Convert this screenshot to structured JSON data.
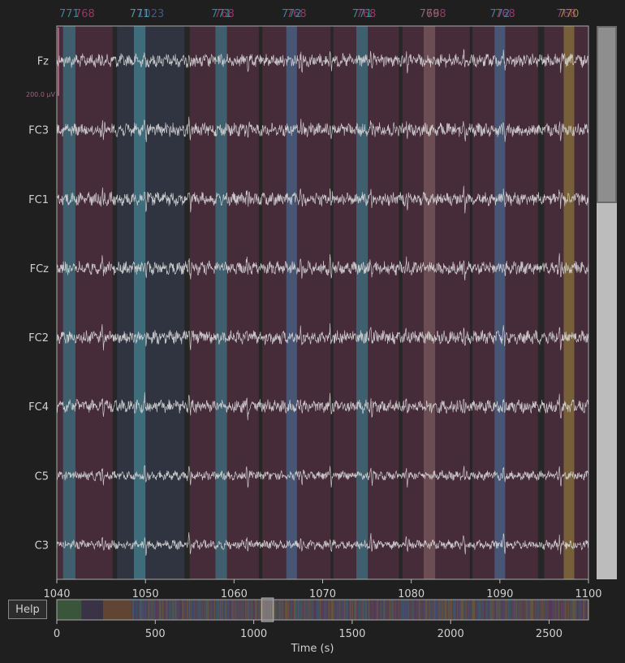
{
  "chart_data": {
    "type": "line",
    "channels": [
      "Fz",
      "FC3",
      "FC1",
      "FCz",
      "FC2",
      "FC4",
      "C5",
      "C3"
    ],
    "xlim": [
      1040,
      1100
    ],
    "xticks": [
      "1040",
      "1050",
      "1060",
      "1070",
      "1080",
      "1090",
      "1100"
    ],
    "scale_label": "200.0 µV",
    "annotations": [
      {
        "label": "768",
        "start": 1040.0,
        "end": 1046.3,
        "color": "#9b3a6a"
      },
      {
        "label": "771",
        "start": 1040.7,
        "end": 1042.1,
        "color": "#3a8a9a"
      },
      {
        "label": "1023",
        "start": 1046.8,
        "end": 1054.4,
        "color": "#4a5a8a"
      },
      {
        "label": "771",
        "start": 1048.7,
        "end": 1050.0,
        "color": "#4a9aaa"
      },
      {
        "label": "768",
        "start": 1055.0,
        "end": 1062.8,
        "color": "#9b3a6a"
      },
      {
        "label": "771",
        "start": 1057.9,
        "end": 1059.2,
        "color": "#3a8a9a"
      },
      {
        "label": "768",
        "start": 1063.2,
        "end": 1070.9,
        "color": "#9b3a6a"
      },
      {
        "label": "772",
        "start": 1065.9,
        "end": 1067.1,
        "color": "#4a7aa8"
      },
      {
        "label": "768",
        "start": 1071.2,
        "end": 1078.6,
        "color": "#9b3a6a"
      },
      {
        "label": "771",
        "start": 1073.8,
        "end": 1075.1,
        "color": "#3a8a9a"
      },
      {
        "label": "768",
        "start": 1079.0,
        "end": 1086.6,
        "color": "#9b3a6a"
      },
      {
        "label": "769",
        "start": 1081.4,
        "end": 1082.7,
        "color": "#8a6a6a"
      },
      {
        "label": "768",
        "start": 1086.9,
        "end": 1094.3,
        "color": "#9b3a6a"
      },
      {
        "label": "772",
        "start": 1089.4,
        "end": 1090.6,
        "color": "#4a7aa8"
      },
      {
        "label": "768",
        "start": 1095.0,
        "end": 1100.0,
        "color": "#9b3a6a"
      },
      {
        "label": "770",
        "start": 1097.2,
        "end": 1098.4,
        "color": "#a08a3a"
      }
    ],
    "overview": {
      "xlim": [
        0,
        2700
      ],
      "xticks": [
        "0",
        "500",
        "1000",
        "1500",
        "2000",
        "2500"
      ],
      "xlabel": "Time (s)",
      "view_start": 1040,
      "view_end": 1100
    },
    "grid": false
  },
  "ui": {
    "help_label": "Help",
    "vertical_scroll_fraction": 0.32
  },
  "colors": {
    "background": "#1f1f1f",
    "trace": "#d8d8d8",
    "axis": "#bdbdbd"
  }
}
